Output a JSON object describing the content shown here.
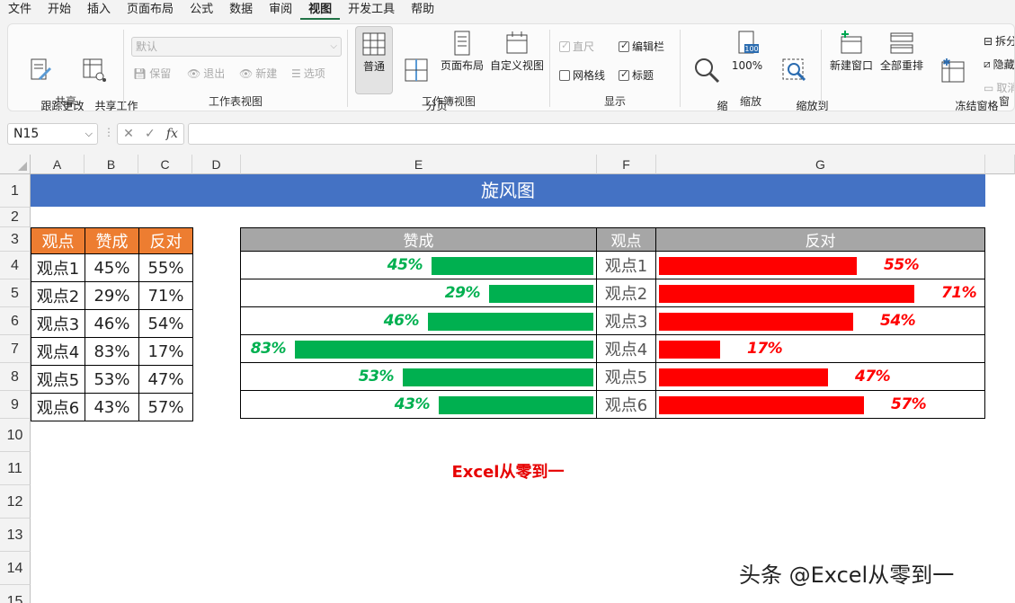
{
  "menu": [
    "文件",
    "开始",
    "插入",
    "页面布局",
    "公式",
    "数据",
    "审阅",
    "视图",
    "开发工具",
    "帮助"
  ],
  "menu_active_index": 7,
  "ribbon": {
    "share": {
      "label": "共享",
      "track_changes": "跟踪更改\n(旧版) ˅",
      "share_workbook": "共享工作\n簿(旧版)"
    },
    "sheet_view": {
      "label": "工作表视图",
      "combo_value": "默认",
      "keep": "保留",
      "exit": "退出",
      "new": "新建",
      "options": "选项"
    },
    "workbook_view": {
      "label": "工作簿视图",
      "normal": "普通",
      "page_break": "分页\n预览",
      "page_layout": "页面布局",
      "custom": "自定义视图"
    },
    "show": {
      "label": "显示",
      "ruler": "直尺",
      "formula_bar": "编辑栏",
      "gridlines": "网格线",
      "headings": "标题"
    },
    "zoom": {
      "label": "缩放",
      "zoom": "缩\n放",
      "zoom100": "100%",
      "zoom_selection": "缩放到\n选定区域",
      "icon_100": "100"
    },
    "window": {
      "label": "窗",
      "new_window": "新建窗口",
      "arrange_all": "全部重排",
      "freeze": "冻结窗格\n˅",
      "split": "拆分",
      "hide": "隐藏",
      "unhide": "取消"
    }
  },
  "formula_bar": {
    "name_box": "N15",
    "fx": "fx",
    "value": ""
  },
  "columns": [
    "A",
    "B",
    "C",
    "D",
    "E",
    "F",
    "G"
  ],
  "rows": [
    "1",
    "2",
    "3",
    "4",
    "5",
    "6",
    "7",
    "8",
    "9",
    "10",
    "11",
    "12",
    "13",
    "14",
    "15"
  ],
  "title": "旋风图",
  "data_table": {
    "headers": [
      "观点",
      "赞成",
      "反对"
    ],
    "rows": [
      [
        "观点1",
        "45%",
        "55%"
      ],
      [
        "观点2",
        "29%",
        "71%"
      ],
      [
        "观点3",
        "46%",
        "54%"
      ],
      [
        "观点4",
        "83%",
        "17%"
      ],
      [
        "观点5",
        "53%",
        "47%"
      ],
      [
        "观点6",
        "43%",
        "57%"
      ]
    ]
  },
  "chart_data": {
    "type": "bar",
    "title": "旋风图",
    "categories": [
      "观点1",
      "观点2",
      "观点3",
      "观点4",
      "观点5",
      "观点6"
    ],
    "headers": [
      "赞成",
      "观点",
      "反对"
    ],
    "series": [
      {
        "name": "赞成",
        "values": [
          45,
          29,
          46,
          83,
          53,
          43
        ],
        "labels": [
          "45%",
          "29%",
          "46%",
          "83%",
          "53%",
          "43%"
        ],
        "color": "#00b050",
        "direction": "left"
      },
      {
        "name": "反对",
        "values": [
          55,
          71,
          54,
          17,
          47,
          57
        ],
        "labels": [
          "55%",
          "71%",
          "54%",
          "17%",
          "47%",
          "57%"
        ],
        "color": "#ff0000",
        "direction": "right"
      }
    ],
    "ylim": [
      0,
      100
    ]
  },
  "caption": "Excel从零到一",
  "watermark": "头条 @Excel从零到一",
  "colors": {
    "title_band": "#4472c4",
    "table_header": "#ed7d31",
    "chart_header": "#a6a6a6",
    "agree": "#00b050",
    "oppose": "#ff0000"
  }
}
